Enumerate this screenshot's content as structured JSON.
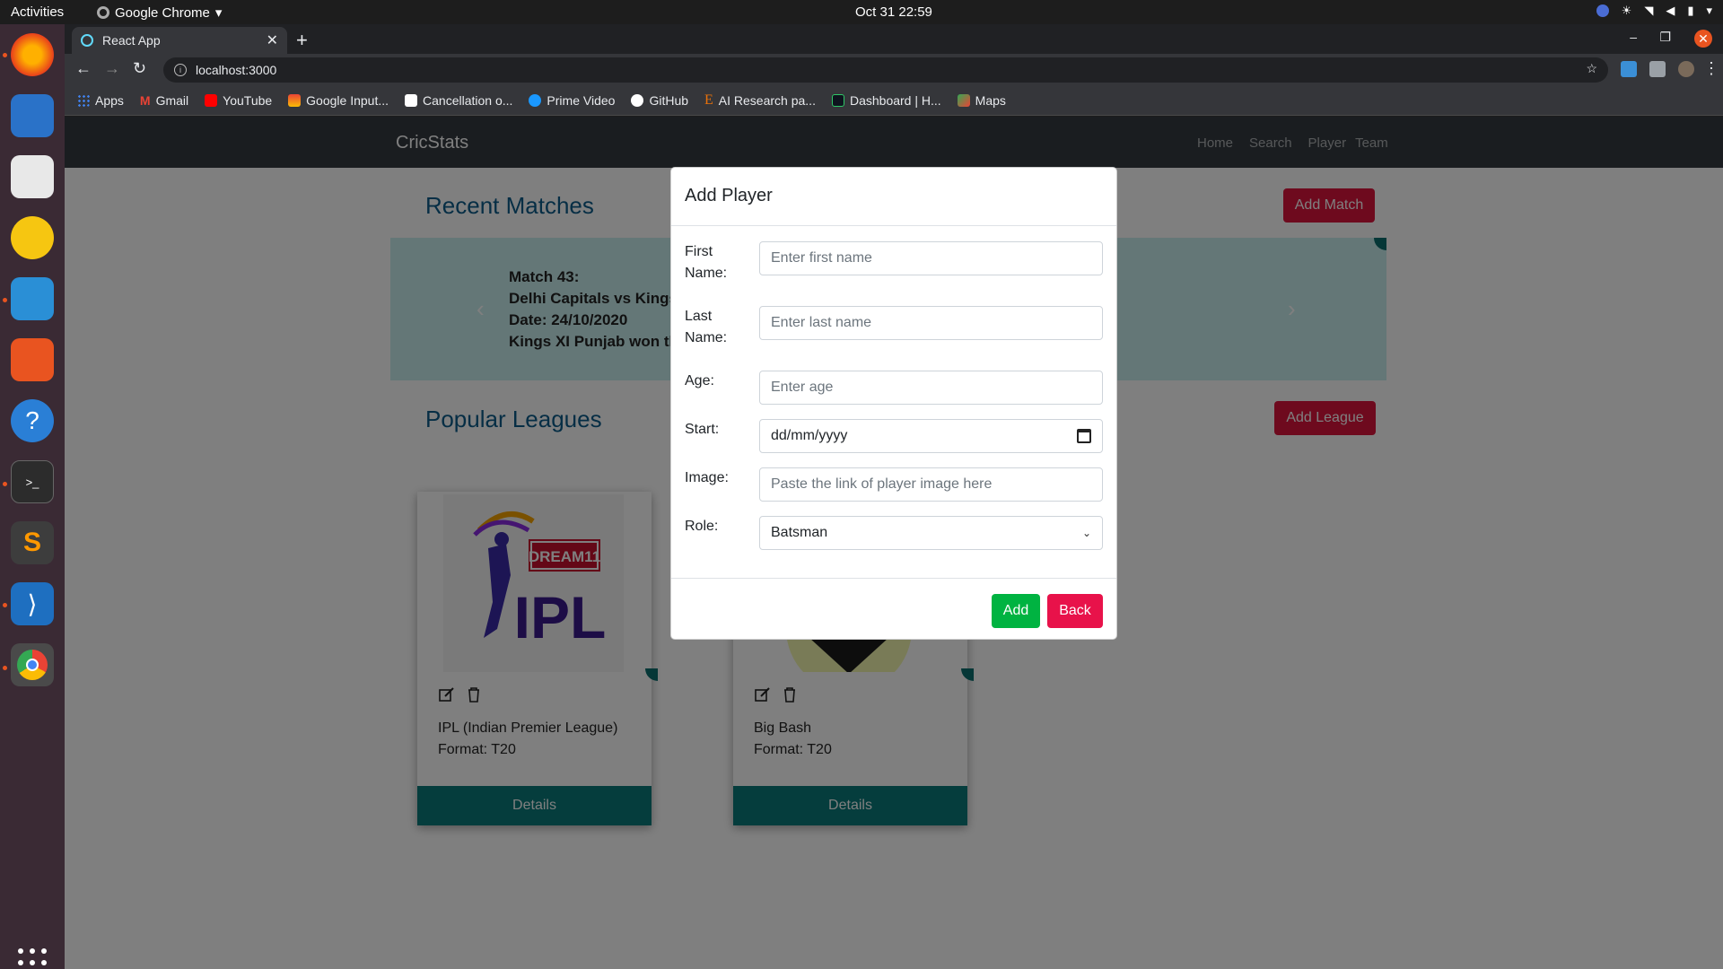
{
  "desktop": {
    "activities": "Activities",
    "app_menu": "Google Chrome",
    "clock": "Oct 31  22:59"
  },
  "browser": {
    "tab_title": "React App",
    "url": "localhost:3000",
    "bookmarks": [
      {
        "label": "Apps",
        "icon": "apps-grid-icon",
        "color": "#4285f4"
      },
      {
        "label": "Gmail",
        "icon": "gmail-icon",
        "color": "#ea4335"
      },
      {
        "label": "YouTube",
        "icon": "youtube-icon",
        "color": "#ff0000"
      },
      {
        "label": "Google Input...",
        "icon": "google-input-icon",
        "color": "#fbbc05"
      },
      {
        "label": "Cancellation o...",
        "icon": "cancellation-icon",
        "color": "#ffffff"
      },
      {
        "label": "Prime Video",
        "icon": "prime-video-icon",
        "color": "#1a98ff"
      },
      {
        "label": "GitHub",
        "icon": "github-icon",
        "color": "#ffffff"
      },
      {
        "label": "AI Research pa...",
        "icon": "ai-research-icon",
        "color": "#e8710a"
      },
      {
        "label": "Dashboard | H...",
        "icon": "dashboard-icon",
        "color": "#2ec866"
      },
      {
        "label": "Maps",
        "icon": "maps-icon",
        "color": "#34a853"
      }
    ]
  },
  "app": {
    "brand": "CricStats",
    "nav": [
      "Home",
      "Search",
      "Player",
      "Team"
    ],
    "recent_title": "Recent Matches",
    "add_match": "Add Match",
    "match": {
      "line1": "Match 43:",
      "line2": "Delhi Capitals vs Kings",
      "line3": "Date: 24/10/2020",
      "line4": "Kings XI Punjab won the"
    },
    "leagues_title": "Popular Leagues",
    "add_league": "Add League",
    "leagues": [
      {
        "title": "IPL (Indian Premier League)",
        "format": "Format: T20",
        "details": "Details",
        "logo_top": "DREAM11",
        "logo_main": "IPL"
      },
      {
        "title": "Big Bash",
        "format": "Format: T20",
        "details": "Details"
      }
    ]
  },
  "modal": {
    "title": "Add Player",
    "fields": {
      "first_name": {
        "label_a": "First",
        "label_b": "Name:",
        "placeholder": "Enter first name"
      },
      "last_name": {
        "label_a": "Last",
        "label_b": "Name:",
        "placeholder": "Enter last name"
      },
      "age": {
        "label": "Age:",
        "placeholder": "Enter age"
      },
      "start": {
        "label": "Start:",
        "value": "dd/mm/yyyy"
      },
      "image": {
        "label": "Image:",
        "placeholder": "Paste the link of player image here"
      },
      "role": {
        "label": "Role:",
        "value": "Batsman"
      }
    },
    "add_btn": "Add",
    "back_btn": "Back"
  },
  "colors": {
    "accent_red": "#dc143c",
    "teal": "#0b7a7a",
    "add_green": "#00b341",
    "back_pink": "#e8124a"
  }
}
